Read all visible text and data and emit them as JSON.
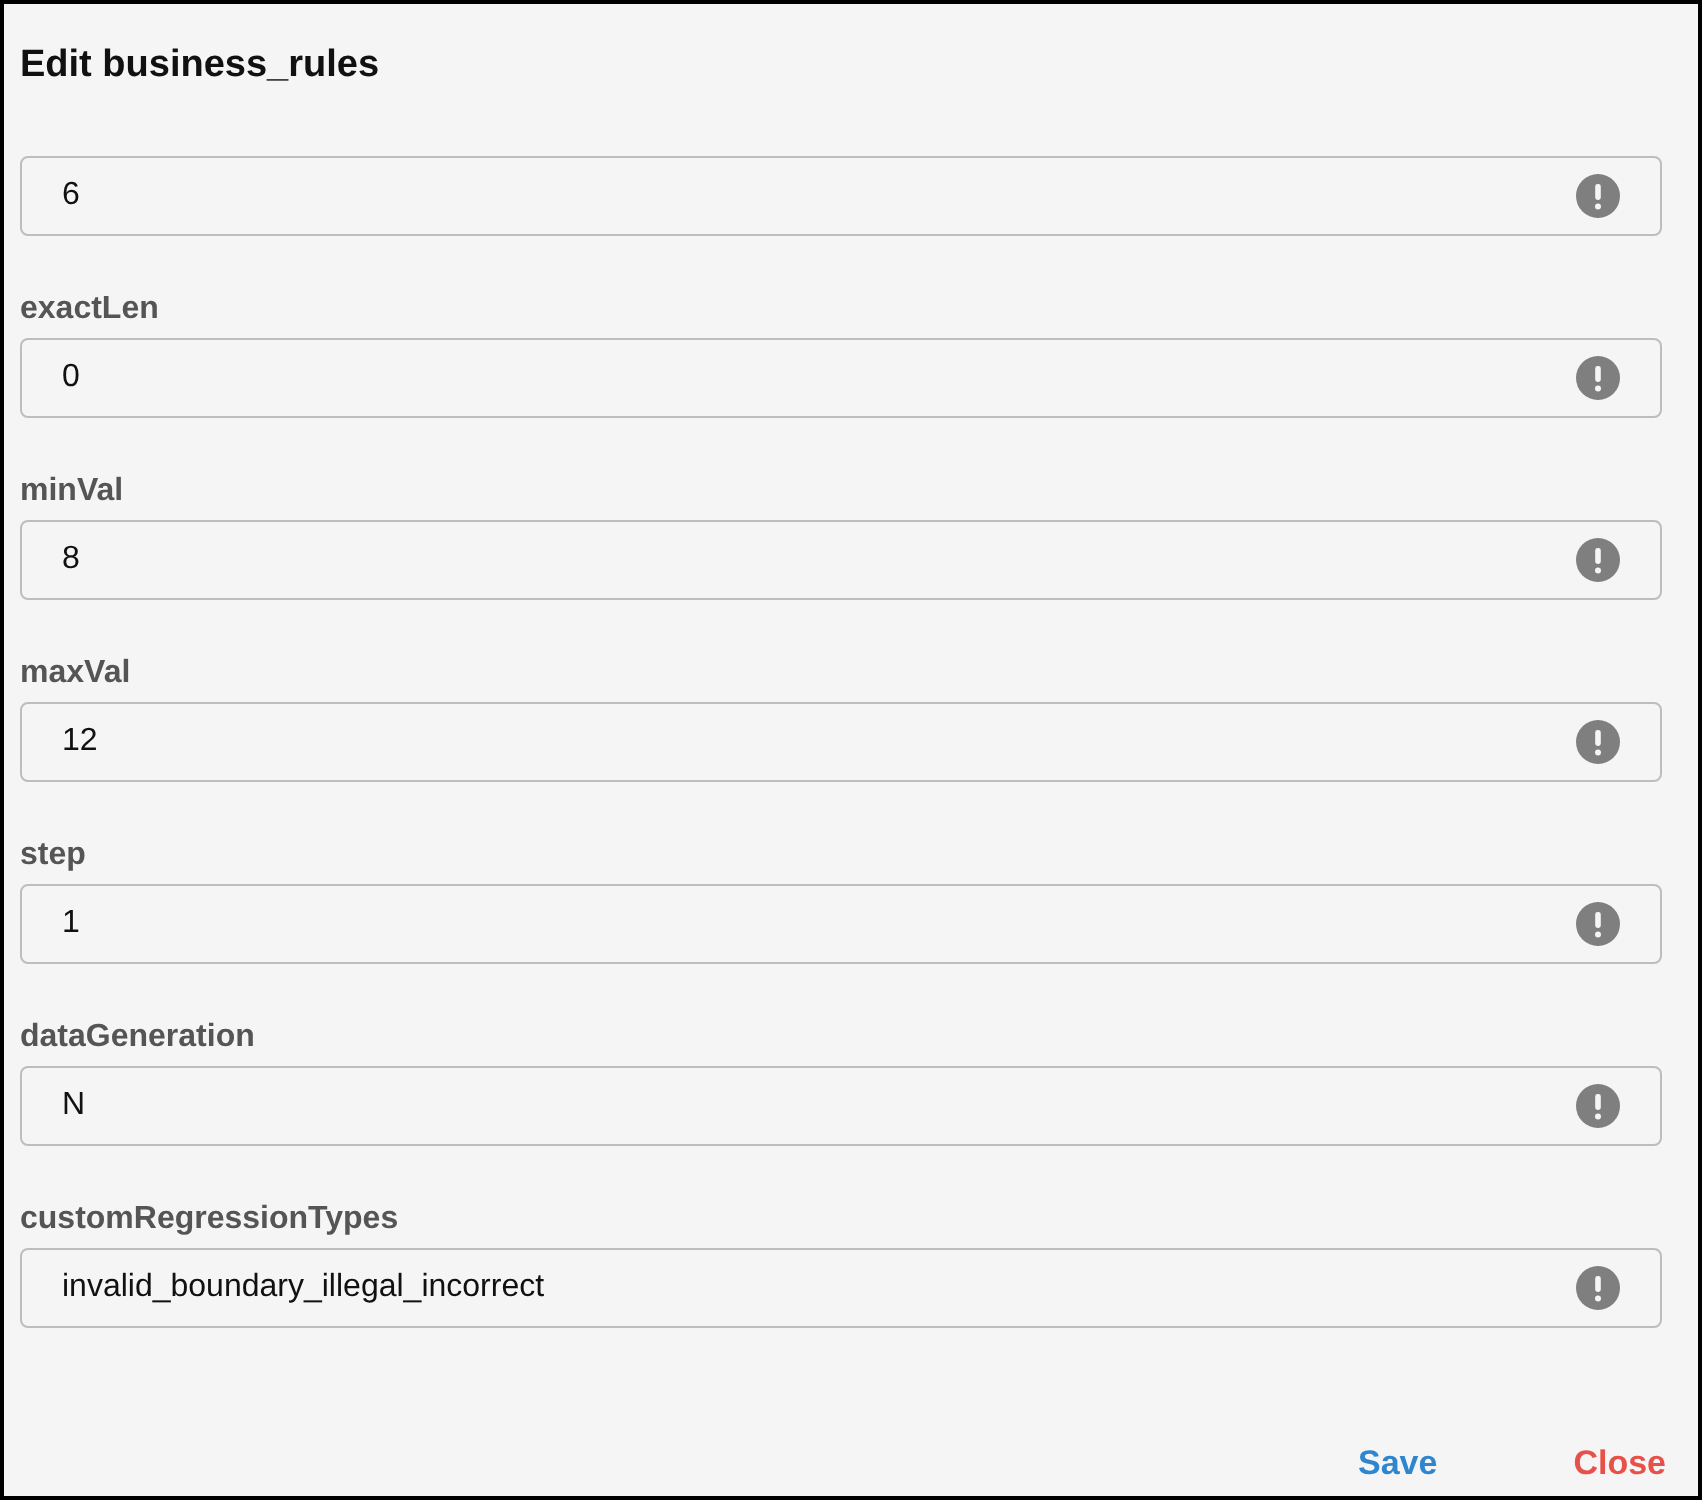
{
  "dialog": {
    "title": "Edit business_rules"
  },
  "fields": [
    {
      "value": "6"
    },
    {
      "label": "exactLen",
      "value": "0"
    },
    {
      "label": "minVal",
      "value": "8"
    },
    {
      "label": "maxVal",
      "value": "12"
    },
    {
      "label": "step",
      "value": "1"
    },
    {
      "label": "dataGeneration",
      "value": "N"
    },
    {
      "label": "customRegressionTypes",
      "value": "invalid_boundary_illegal_incorrect"
    }
  ],
  "buttons": [
    {
      "label": "Save",
      "kind": "primary"
    },
    {
      "label": "Close",
      "kind": "danger"
    }
  ]
}
